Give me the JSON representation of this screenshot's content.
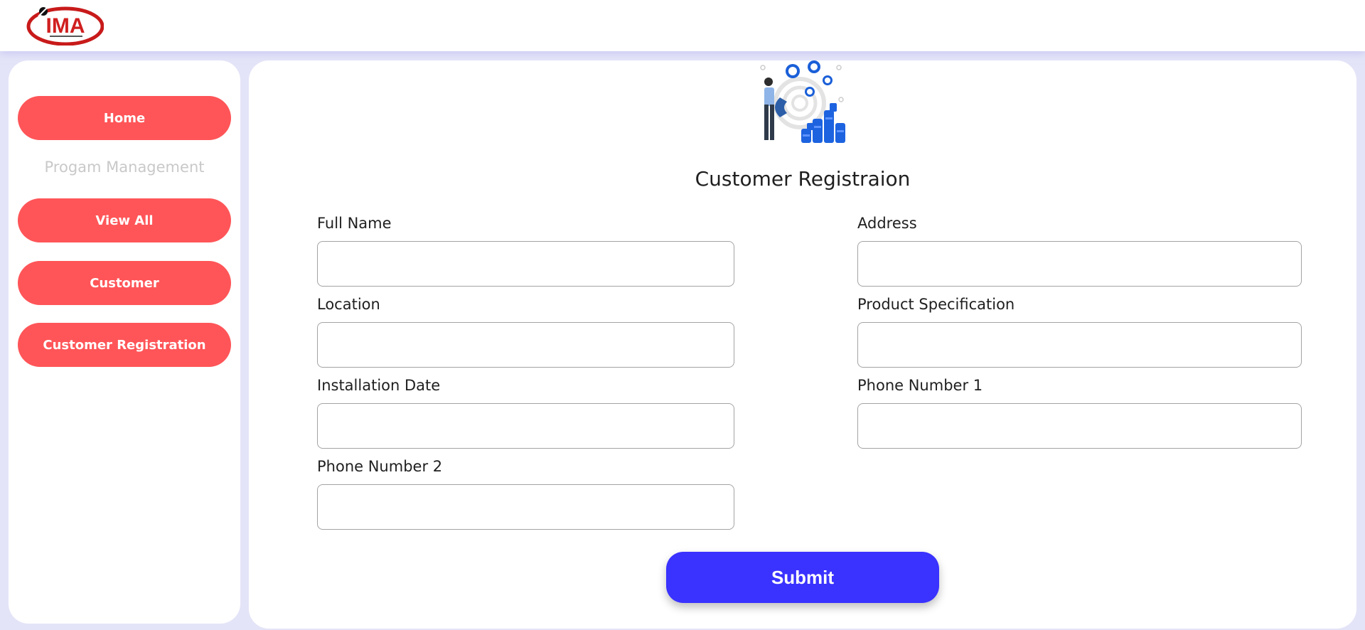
{
  "header": {
    "logo_text": "IMA",
    "logo_color": "#d01f1f"
  },
  "sidebar": {
    "items": [
      {
        "label": "Home"
      },
      {
        "label": "View All"
      },
      {
        "label": "Customer"
      },
      {
        "label": "Customer Registration"
      }
    ],
    "section_label": "Progam Management",
    "button_color": "#ff5558"
  },
  "form": {
    "title": "Customer Registraion",
    "fields": {
      "full_name": {
        "label": "Full Name",
        "value": ""
      },
      "address": {
        "label": "Address",
        "value": ""
      },
      "location": {
        "label": "Location",
        "value": ""
      },
      "product_specification": {
        "label": "Product Specification",
        "value": ""
      },
      "installation_date": {
        "label": "Installation Date",
        "value": ""
      },
      "phone_number_1": {
        "label": "Phone Number 1",
        "value": ""
      },
      "phone_number_2": {
        "label": "Phone Number 2",
        "value": ""
      }
    },
    "submit_label": "Submit",
    "submit_color": "#3a32ff"
  },
  "icons": {
    "logo": "ima-logo",
    "illustration": "customer-magnet-illustration"
  }
}
